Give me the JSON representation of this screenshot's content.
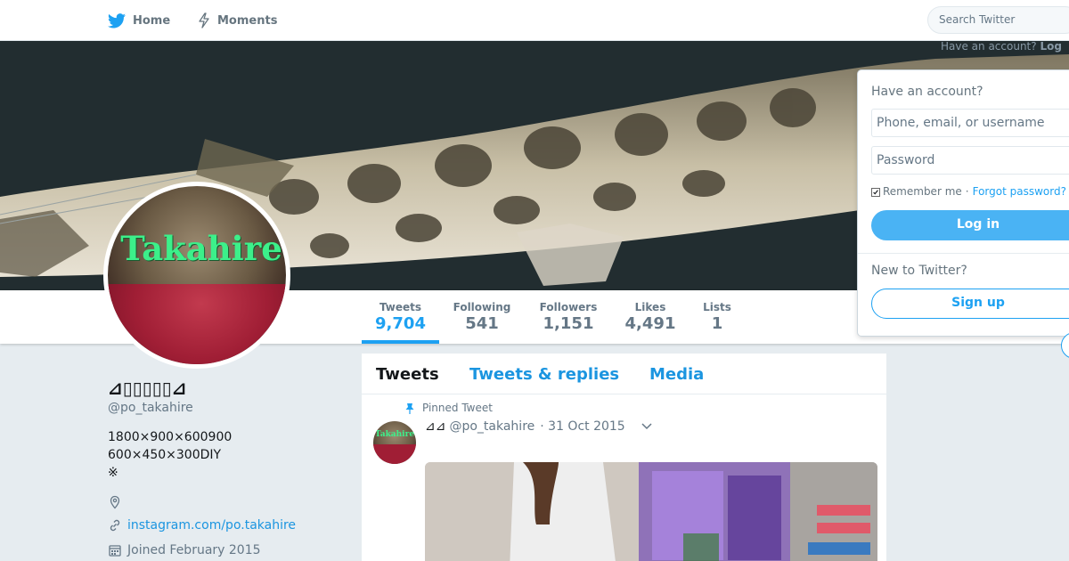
{
  "nav": {
    "home_label": "Home",
    "moments_label": "Moments",
    "search_placeholder": "Search Twitter",
    "have_account": "Have an account?",
    "login_short": "Log"
  },
  "stats": {
    "tweets": {
      "label": "Tweets",
      "value": "9,704"
    },
    "following": {
      "label": "Following",
      "value": "541"
    },
    "followers": {
      "label": "Followers",
      "value": "1,151"
    },
    "likes": {
      "label": "Likes",
      "value": "4,491"
    },
    "lists": {
      "label": "Lists",
      "value": "1"
    }
  },
  "profile": {
    "avatar_text": "Takahire",
    "name": "⊿▯▯▯▯▯⊿",
    "handle": "@po_takahire",
    "bio": "1800×900×600900\n600×450×300DIY\n※",
    "link": "instagram.com/po.takahire",
    "joined": "Joined February 2015"
  },
  "timeline": {
    "tabs": [
      "Tweets",
      "Tweets & replies",
      "Media"
    ],
    "pinned_label": "Pinned Tweet",
    "tweet": {
      "avatar_text": "Takahire",
      "name": "⊿⊿",
      "handle": "@po_takahire",
      "date": "· 31 Oct 2015"
    }
  },
  "login": {
    "header": "Have an account?",
    "username_placeholder": "Phone, email, or username",
    "password_placeholder": "Password",
    "remember": "Remember me",
    "dot": "·",
    "forgot": "Forgot password?",
    "login_button": "Log in",
    "new_label": "New to Twitter?",
    "signup_button": "Sign up"
  },
  "colors": {
    "accent": "#1da1f2",
    "login_button": "#4ab3f4",
    "avatar_text": "#3cf08a"
  },
  "icons": [
    "twitter-bird-icon",
    "lightning-icon",
    "pin-icon",
    "location-icon",
    "link-icon",
    "calendar-icon",
    "chevron-down-icon"
  ]
}
